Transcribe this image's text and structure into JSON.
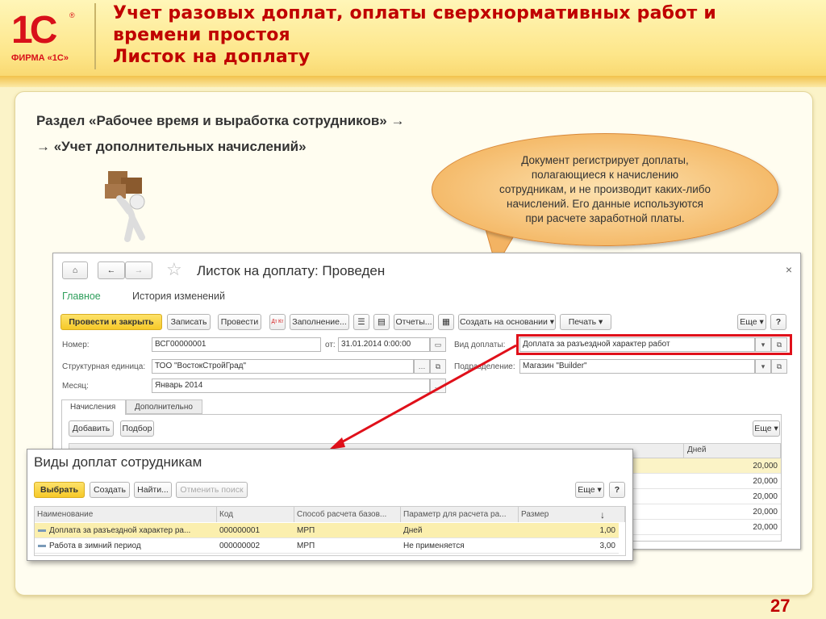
{
  "header": {
    "logo_mark": "1С",
    "logo_text": "ФИРМА «1С»",
    "title_lines": [
      "Учет разовых доплат, оплаты сверхнормативных работ и",
      "времени простоя",
      "Листок на доплату"
    ]
  },
  "section": {
    "line1": "Раздел «Рабочее время и выработка сотрудников» →",
    "line2": "→ «Учет дополнительных начислений»"
  },
  "callout": "Документ регистрирует доплаты,\nполагающиеся к начислению\nсотрудникам, и не производит каких-либо\nначислений. Его данные используются\nпри расчете заработной платы.",
  "document": {
    "title": "Листок на доплату: Проведен",
    "tabs": [
      "Главное",
      "История изменений"
    ],
    "toolbar": {
      "post_close": "Провести и закрыть",
      "save": "Записать",
      "post": "Провести",
      "dtkt": "Дт Кт",
      "fill": "Заполнение...",
      "reports": "Отчеты...",
      "create_based": "Создать на основании ▾",
      "print": "Печать ▾",
      "more": "Еще ▾",
      "help": "?"
    },
    "fields": {
      "number_label": "Номер:",
      "number": "ВСГ00000001",
      "date_label": "от:",
      "date": "31.01.2014  0:00:00",
      "unit_label": "Структурная единица:",
      "unit": "ТОО \"ВостокСтройГрад\"",
      "month_label": "Месяц:",
      "month": "Январь 2014",
      "kind_label": "Вид доплаты:",
      "kind": "Доплата за разъездной характер работ",
      "dept_label": "Подразделение:",
      "dept": "Магазин \"Builder\""
    },
    "inner_tabs": [
      "Начисления",
      "Дополнительно"
    ],
    "table_buttons": {
      "add": "Добавить",
      "pick": "Подбор",
      "more": "Еще ▾"
    },
    "table": {
      "days_header": "Дней",
      "days": [
        "20,000",
        "20,000",
        "20,000",
        "20,000",
        "20,000"
      ]
    }
  },
  "popup": {
    "title": "Виды доплат сотрудникам",
    "buttons": {
      "select": "Выбрать",
      "create": "Создать",
      "find": "Найти...",
      "cancel_search": "Отменить поиск",
      "more": "Еще ▾",
      "help": "?"
    },
    "columns": [
      "Наименование",
      "Код",
      "Способ расчета базов...",
      "Параметр для расчета ра...",
      "Размер"
    ],
    "sort_indicator": "↓",
    "rows": [
      [
        "Доплата за разъездной характер ра...",
        "000000001",
        "МРП",
        "Дней",
        "1,00"
      ],
      [
        "Работа в зимний период",
        "000000002",
        "МРП",
        "Не применяется",
        "3,00"
      ]
    ]
  },
  "page_number": "27",
  "colors": {
    "accent_red": "#c00000",
    "highlight": "#fbf3c6",
    "green_tab": "#2e9e5b"
  }
}
